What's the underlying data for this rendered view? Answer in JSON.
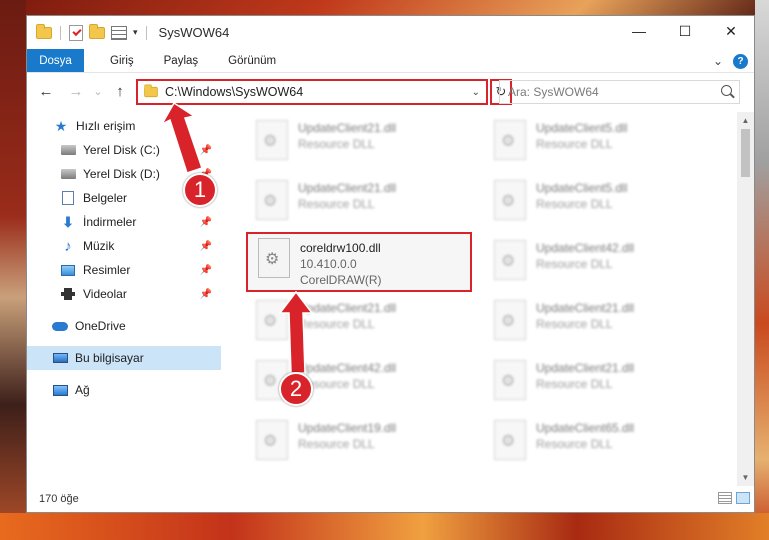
{
  "window": {
    "title": "SysWOW64",
    "controls": {
      "minimize": "—",
      "maximize": "☐",
      "close": "✕"
    }
  },
  "ribbon": {
    "tabs": [
      "Dosya",
      "Giriş",
      "Paylaş",
      "Görünüm"
    ],
    "expand": "⌄",
    "help": "?"
  },
  "navbar": {
    "back": "←",
    "forward": "→",
    "recent": "⌄",
    "up": "↑",
    "address": "C:\\Windows\\SysWOW64",
    "address_dropdown": "⌄",
    "refresh": "↻",
    "search_placeholder": "Ara: SysWOW64"
  },
  "sidebar": {
    "items": [
      {
        "label": "Hızlı erişim",
        "icon": "star-icon",
        "pinned": false
      },
      {
        "label": "Yerel Disk (C:)",
        "icon": "drive-icon",
        "pinned": true
      },
      {
        "label": "Yerel Disk (D:)",
        "icon": "drive-icon",
        "pinned": true
      },
      {
        "label": "Belgeler",
        "icon": "document-icon",
        "pinned": true
      },
      {
        "label": "İndirmeler",
        "icon": "download-icon",
        "pinned": true
      },
      {
        "label": "Müzik",
        "icon": "music-icon",
        "pinned": true
      },
      {
        "label": "Resimler",
        "icon": "pictures-icon",
        "pinned": true
      },
      {
        "label": "Videolar",
        "icon": "videos-icon",
        "pinned": true
      },
      {
        "label": "OneDrive",
        "icon": "cloud-icon",
        "pinned": false
      },
      {
        "label": "Bu bilgisayar",
        "icon": "computer-icon",
        "pinned": false,
        "selected": true
      },
      {
        "label": "Ağ",
        "icon": "network-icon",
        "pinned": false
      }
    ]
  },
  "files": {
    "highlighted": {
      "name": "coreldrw100.dll",
      "version": "10.410.0.0",
      "company": "CorelDRAW(R)"
    },
    "blurred_left": [
      {
        "name": "UpdateClient21.dll",
        "desc": "Resource DLL"
      },
      {
        "name": "UpdateClient21.dll",
        "desc": "Resource DLL"
      },
      {
        "name": "UpdateClient21.dll",
        "desc": "Resource DLL"
      },
      {
        "name": "UpdateClient42.dll",
        "desc": "Resource DLL"
      },
      {
        "name": "UpdateClient19.dll",
        "desc": "Resource DLL"
      }
    ],
    "blurred_right": [
      {
        "name": "UpdateClient5.dll",
        "desc": "Resource DLL"
      },
      {
        "name": "UpdateClient5.dll",
        "desc": "Resource DLL"
      },
      {
        "name": "UpdateClient42.dll",
        "desc": "Resource DLL"
      },
      {
        "name": "UpdateClient21.dll",
        "desc": "Resource DLL"
      },
      {
        "name": "UpdateClient21.dll",
        "desc": "Resource DLL"
      },
      {
        "name": "UpdateClient65.dll",
        "desc": "Resource DLL"
      }
    ]
  },
  "status": {
    "item_count": "170 öğe"
  },
  "callouts": {
    "one": "1",
    "two": "2"
  },
  "colors": {
    "accent": "#1979ca",
    "highlight": "#d9232a",
    "selected": "#cce4f7"
  }
}
